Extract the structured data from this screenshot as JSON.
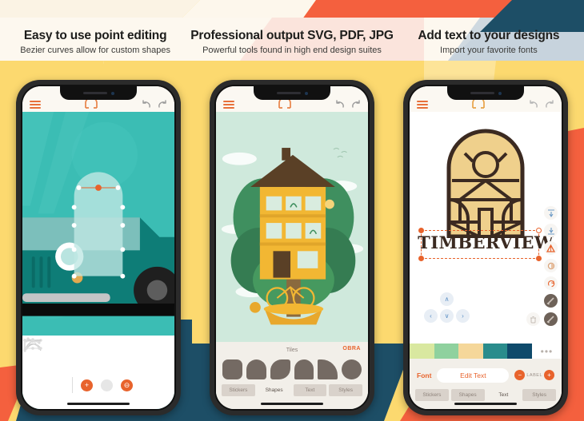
{
  "panels": [
    {
      "title": "Easy to use point editing",
      "subtitle": "Bezier curves allow for custom shapes"
    },
    {
      "title": "Professional output SVG, PDF, JPG",
      "subtitle": "Powerful tools found in high end design suites"
    },
    {
      "title": "Add text to your designs",
      "subtitle": "Import your favorite fonts"
    }
  ],
  "appbar": {
    "menu_icon": "hamburger-menu-icon",
    "logo_icon": "magnet-logo-icon",
    "undo_icon": "undo-arrow-icon",
    "redo_icon": "redo-arrow-icon"
  },
  "phone1": {
    "canvas_label": "van-illustration-with-bezier-path",
    "curve_tools": [
      "corner-point-icon",
      "smooth-curve-icon",
      "asymmetric-curve-icon",
      "arc-curve-icon"
    ],
    "node_tool": "node-triangle-icon",
    "add_label": "+",
    "neutral_label": "",
    "delete_label": "⊖"
  },
  "phone2": {
    "panel_label": "Tiles",
    "brandmark": "OBRA",
    "shape_swatches": [
      "rounded-square-shape",
      "leaf-top-shape",
      "leaf-diagonal-shape",
      "arch-shape",
      "quarter-circle-shape",
      "ellipse-shape"
    ],
    "tabs": [
      {
        "label": "Stickers",
        "active": false
      },
      {
        "label": "Shapes",
        "active": true
      },
      {
        "label": "Text",
        "active": false
      },
      {
        "label": "Styles",
        "active": false
      }
    ]
  },
  "phone3": {
    "logo_text": "TIMBERVIEW",
    "side_tools": [
      "align-top-icon",
      "align-bottom-icon",
      "flip-warning-icon",
      "shape-fill-icon",
      "rotate-right-icon",
      "brush-swatch-icon"
    ],
    "dpad": {
      "up": "∧",
      "left": "‹",
      "down": "∨",
      "right": "›"
    },
    "transform_buttons": [
      "trash-icon",
      "brush-swatch-icon"
    ],
    "palette": [
      "#d9e8a0",
      "#8fd19e",
      "#f5d79a",
      "#2a8c8c",
      "#0f4a6b"
    ],
    "more_label": "•••",
    "font_label": "Font",
    "edit_text_label": "Edit Text",
    "stepper_minus": "−",
    "stepper_plus": "+",
    "stepper_value": "LABEL",
    "tabs": [
      {
        "label": "Stickers",
        "active": false
      },
      {
        "label": "Shapes",
        "active": false
      },
      {
        "label": "Text",
        "active": true
      },
      {
        "label": "Styles",
        "active": false
      }
    ]
  },
  "colors": {
    "yellow": "#fcd96f",
    "cream": "#fbf3e4",
    "orange": "#f4603e",
    "navy": "#1d4e66",
    "accent": "#e8632c",
    "teal": "#3bbdb4"
  }
}
